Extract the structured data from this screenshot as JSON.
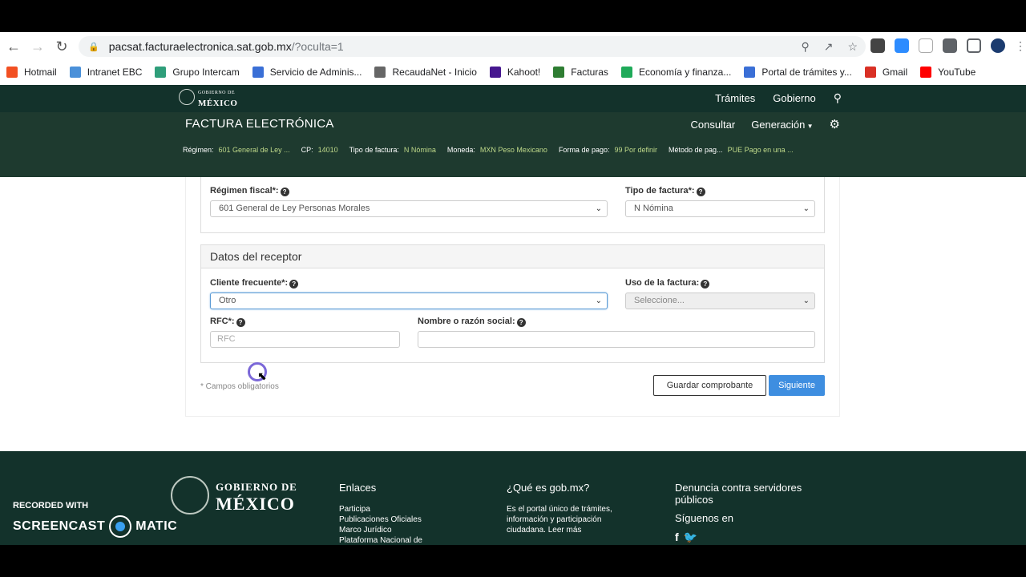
{
  "browser": {
    "url_host": "pacsat.facturaelectronica.sat.gob.mx",
    "url_path": "/?oculta=1",
    "bookmarks": [
      {
        "label": "Hotmail",
        "icon": "windows-icon",
        "color": "#f25022"
      },
      {
        "label": "Intranet EBC",
        "icon": "leaf-icon",
        "color": "#4a90d9"
      },
      {
        "label": "Grupo Intercam",
        "icon": "circle-icon",
        "color": "#2f9e7a"
      },
      {
        "label": "Servicio de Adminis...",
        "icon": "apps-icon",
        "color": "#3a6fd6"
      },
      {
        "label": "RecaudaNet - Inicio",
        "icon": "globe-icon",
        "color": "#666666"
      },
      {
        "label": "Kahoot!",
        "icon": "kahoot-icon",
        "color": "#46178f"
      },
      {
        "label": "Facturas",
        "icon": "grid-icon",
        "color": "#2e7d32"
      },
      {
        "label": "Economía y finanza...",
        "icon": "check-icon",
        "color": "#1faa59"
      },
      {
        "label": "Portal de trámites y...",
        "icon": "apps-icon",
        "color": "#3a6fd6"
      },
      {
        "label": "Gmail",
        "icon": "gmail-icon",
        "color": "#d93025"
      },
      {
        "label": "YouTube",
        "icon": "youtube-icon",
        "color": "#ff0000"
      }
    ]
  },
  "gob_header": {
    "logo_small": "GOBIERNO DE",
    "logo_big": "MÉXICO",
    "nav": [
      "Trámites",
      "Gobierno"
    ]
  },
  "app_header": {
    "title": "FACTURA ELECTRÓNICA",
    "nav_consultar": "Consultar",
    "nav_generacion": "Generación",
    "summary": [
      {
        "key": "Régimen:",
        "value": "601 General de Ley ..."
      },
      {
        "key": "CP:",
        "value": "14010"
      },
      {
        "key": "Tipo de factura:",
        "value": "N Nómina"
      },
      {
        "key": "Moneda:",
        "value": "MXN Peso Mexicano"
      },
      {
        "key": "Forma de pago:",
        "value": "99 Por definir"
      },
      {
        "key": "Método de pag...",
        "value": "PUE Pago en una ..."
      }
    ]
  },
  "form": {
    "regimen_label": "Régimen fiscal*:",
    "regimen_value": "601 General de Ley Personas Morales",
    "tipo_label": "Tipo de factura*:",
    "tipo_value": "N Nómina",
    "receptor_title": "Datos del receptor",
    "cliente_label": "Cliente frecuente*:",
    "cliente_value": "Otro",
    "uso_label": "Uso de la factura:",
    "uso_value": "Seleccione...",
    "rfc_label": "RFC*:",
    "rfc_placeholder": "RFC",
    "nombre_label": "Nombre o razón social:",
    "nombre_value": "",
    "required_note": "* Campos obligatorios",
    "save_label": "Guardar comprobante",
    "next_label": "Siguiente"
  },
  "footer": {
    "logo_l1": "GOBIERNO DE",
    "logo_l2": "MÉXICO",
    "col1_title": "Enlaces",
    "col1_items": [
      "Participa",
      "Publicaciones Oficiales",
      "Marco Jurídico",
      "Plataforma Nacional de"
    ],
    "col2_title": "¿Qué es gob.mx?",
    "col2_text": "Es el portal único de trámites, información y participación ciudadana. Leer más",
    "col3_title": "Denuncia contra servidores públicos",
    "col3_follow": "Síguenos en"
  },
  "watermark": {
    "recorded": "RECORDED WITH",
    "brand_left": "SCREENCAST",
    "brand_right": "MATIC"
  }
}
